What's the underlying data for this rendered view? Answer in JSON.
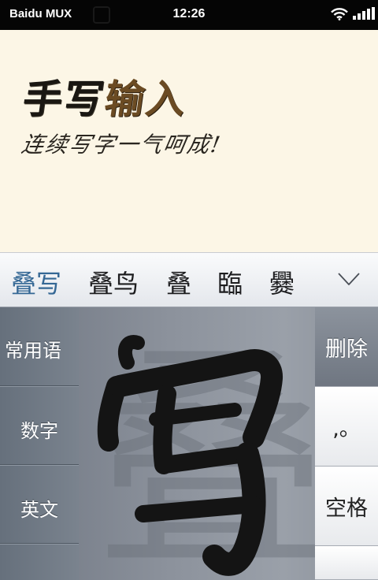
{
  "status_bar": {
    "carrier": "Baidu MUX",
    "time": "12:26",
    "icons": [
      "wifi-icon",
      "signal-icon"
    ]
  },
  "hero": {
    "title_main": "手写",
    "title_accent": "输入",
    "subtitle": "连续写字一气呵成!"
  },
  "candidates": {
    "items": [
      "叠写",
      "叠鸟",
      "叠",
      "臨",
      "爨"
    ],
    "selected_index": 0,
    "collapse_icon": "triangle-down-icon"
  },
  "keyboard": {
    "left_keys": [
      "常用语",
      "数字",
      "英文"
    ],
    "right_keys": [
      "删除",
      ",。",
      "空格"
    ],
    "handwriting_glyph": "写",
    "ghost_glyph": "叠"
  },
  "colors": {
    "hero_background": "#fcf6e6",
    "title_accent": "#6b4b23",
    "selected_candidate": "#356895"
  }
}
